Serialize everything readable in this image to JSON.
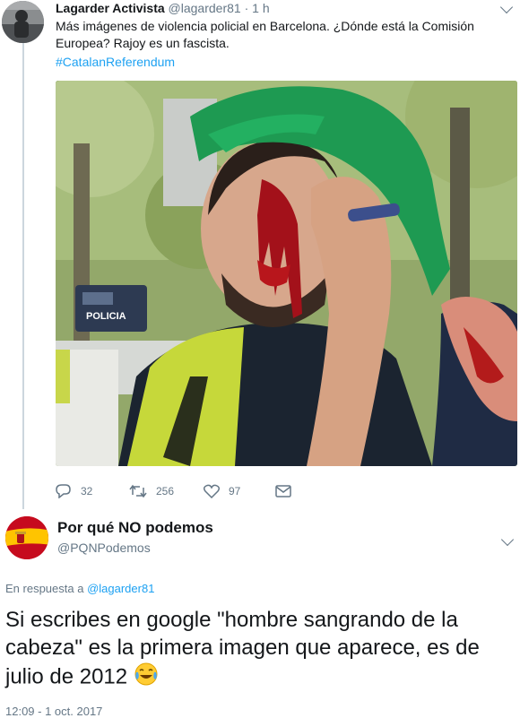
{
  "tweet": {
    "author_name": "Lagarder Activista",
    "author_handle": "@lagarder81",
    "separator": "·",
    "time": "1 h",
    "text": "Más imágenes de violencia policial en Barcelona. ¿Dónde está la Comisión Europea? Rajoy es un fascista.",
    "hashtag": "#CatalanReferendum",
    "photo_sign_text": "POLICIA",
    "actions": {
      "reply_count": "32",
      "retweet_count": "256",
      "like_count": "97"
    }
  },
  "reply": {
    "author_name": "Por qué NO podemos",
    "author_handle": "@PQNPodemos",
    "in_reply_prefix": "En respuesta a",
    "in_reply_handle": "@lagarder81",
    "text": "Si escribes en google \"hombre sangrando de la cabeza\" es la primera imagen que aparece, es de julio de 2012",
    "timestamp": "12:09 - 1 oct. 2017"
  },
  "colors": {
    "link": "#1da1f2",
    "muted": "#657786",
    "text": "#14171a",
    "divider": "#ccd6dd"
  },
  "icons": [
    "reply-icon",
    "retweet-icon",
    "like-icon",
    "direct-message-icon",
    "chevron-down-icon",
    "tears-of-joy-emoji"
  ]
}
